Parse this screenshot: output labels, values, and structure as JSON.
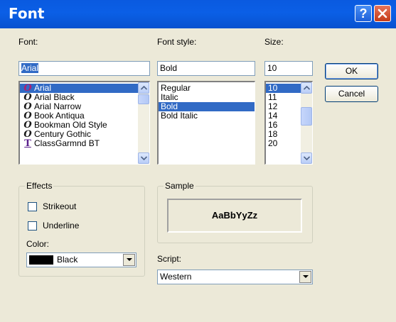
{
  "window": {
    "title": "Font",
    "help_glyph": "?",
    "close_icon": "close-icon"
  },
  "font": {
    "label": "Font:",
    "value": "Arial",
    "items": [
      {
        "name": "Arial",
        "icon": "opentype-font-icon",
        "selected": true
      },
      {
        "name": "Arial Black",
        "icon": "opentype-font-icon"
      },
      {
        "name": "Arial Narrow",
        "icon": "opentype-font-icon"
      },
      {
        "name": "Book Antiqua",
        "icon": "opentype-font-icon"
      },
      {
        "name": "Bookman Old Style",
        "icon": "opentype-font-icon"
      },
      {
        "name": "Century Gothic",
        "icon": "opentype-font-icon"
      },
      {
        "name": "ClassGarmnd BT",
        "icon": "truetype-font-icon"
      }
    ]
  },
  "font_style": {
    "label": "Font style:",
    "value": "Bold",
    "items": [
      "Regular",
      "Italic",
      "Bold",
      "Bold Italic"
    ],
    "selected": "Bold"
  },
  "size": {
    "label": "Size:",
    "value": "10",
    "items": [
      "10",
      "11",
      "12",
      "14",
      "16",
      "18",
      "20"
    ],
    "selected": "10"
  },
  "buttons": {
    "ok": "OK",
    "cancel": "Cancel"
  },
  "effects": {
    "label": "Effects",
    "strikeout": {
      "label": "Strikeout",
      "checked": false
    },
    "underline": {
      "label": "Underline",
      "checked": false
    },
    "color_label": "Color:",
    "color_value": "Black",
    "color_hex": "#000000"
  },
  "sample": {
    "label": "Sample",
    "text": "AaBbYyZz"
  },
  "script": {
    "label": "Script:",
    "value": "Western"
  },
  "colors": {
    "titlebar": "#0b5fe6",
    "selection": "#316ac5",
    "face": "#ece9d8",
    "opentype_icon": "#1a1a1a",
    "truetype_icon": "#5a1f8c",
    "selected_icon": "#b02070"
  }
}
